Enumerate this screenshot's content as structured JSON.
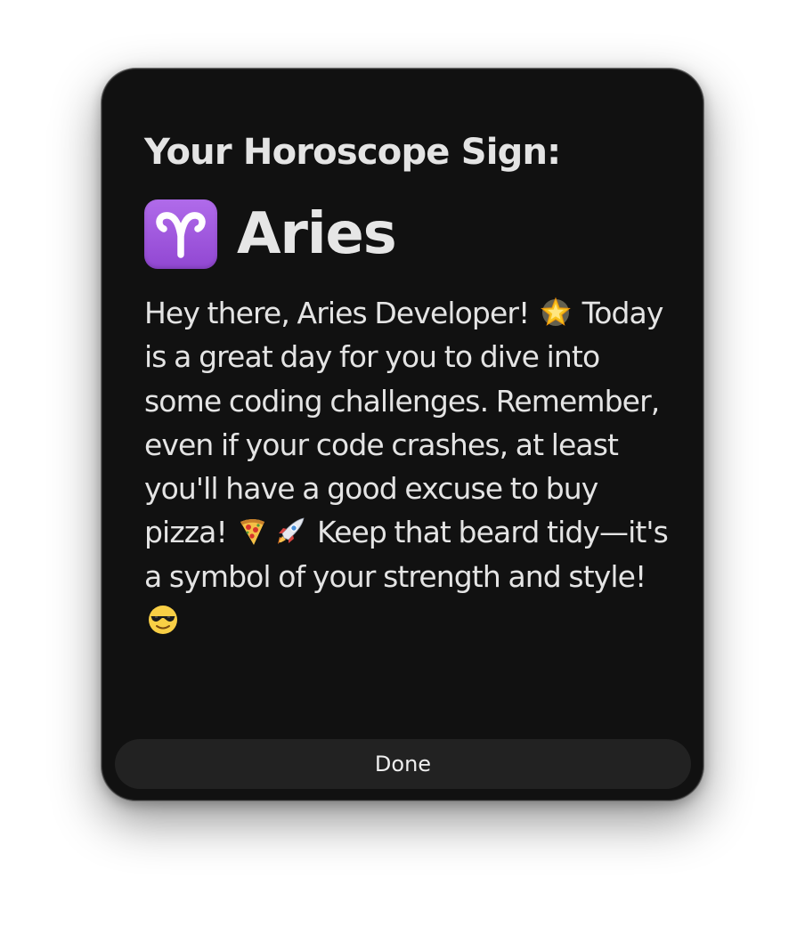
{
  "dialog": {
    "heading": "Your Horoscope Sign:",
    "sign": {
      "icon": "aries-symbol-icon",
      "name": "Aries"
    },
    "message": {
      "line1": "Hey there, Aries Developer!",
      "line1_emoji": "glowing-star-icon",
      "line2": "Today is a great day for you to dive into some coding challenges. Remember, even if your code crashes, at least you'll have a good excuse to buy pizza!",
      "line2_emojis": [
        "pizza-icon",
        "rocket-icon"
      ],
      "line3": "Keep that beard tidy—it's a symbol of your strength and style!",
      "line3_emoji": "smiling-face-with-sunglasses-icon"
    },
    "done_label": "Done"
  },
  "colors": {
    "background": "#111111",
    "text": "#e4e4e4",
    "button": "#222222",
    "aries_badge": "#9f59e0"
  }
}
